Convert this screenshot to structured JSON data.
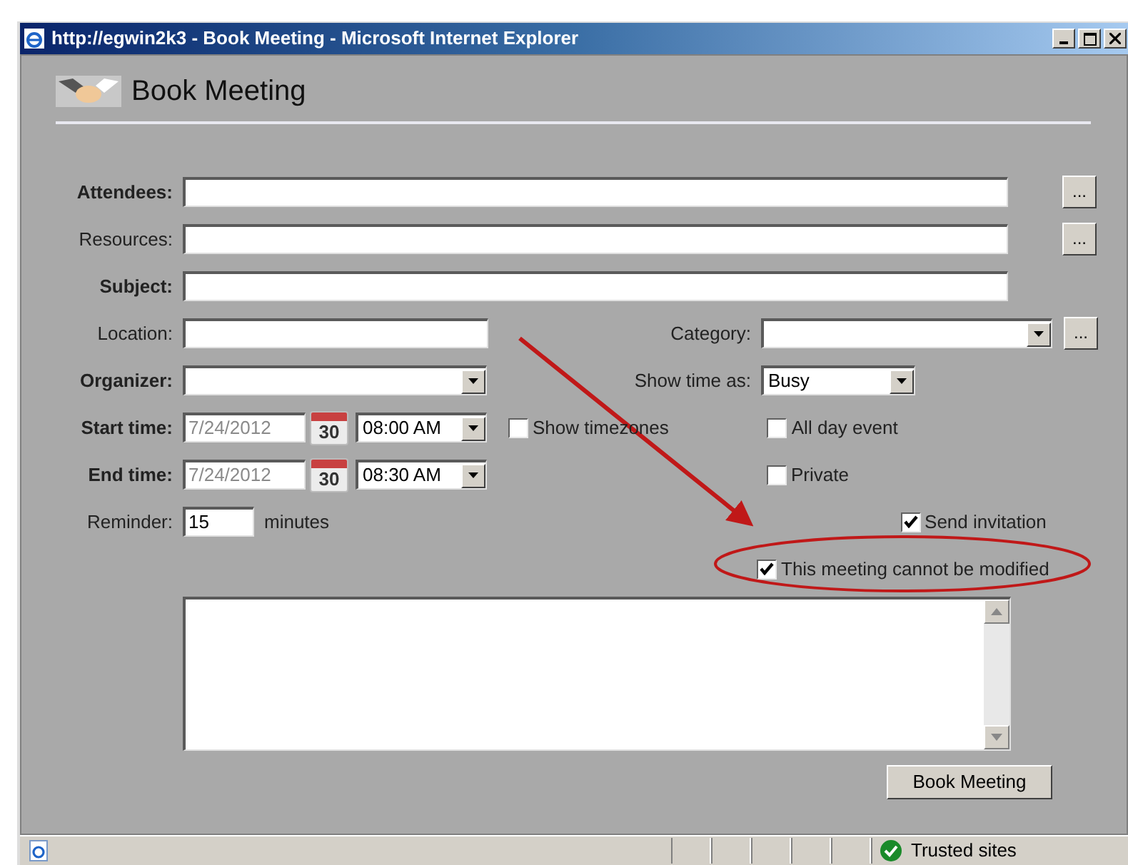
{
  "window": {
    "title": "http://egwin2k3 - Book Meeting - Microsoft Internet Explorer"
  },
  "heading": "Book Meeting",
  "attendees": {
    "label": "Attendees:",
    "button": "..."
  },
  "resources": {
    "label": "Resources:",
    "button": "..."
  },
  "subject": {
    "label": "Subject:"
  },
  "location": {
    "label": "Location:"
  },
  "category": {
    "label": "Category:",
    "button": "..."
  },
  "organizer": {
    "label": "Organizer:"
  },
  "show_time_as": {
    "label": "Show time as:",
    "value": "Busy"
  },
  "start_time": {
    "label": "Start time:",
    "date": "7/24/2012",
    "calendar_day": "30",
    "time": "08:00 AM"
  },
  "end_time": {
    "label": "End time:",
    "date": "7/24/2012",
    "calendar_day": "30",
    "time": "08:30 AM"
  },
  "reminder": {
    "label": "Reminder:",
    "value": "15",
    "unit": "minutes"
  },
  "checkboxes": [
    {
      "label": "Show timezones",
      "checked": false
    },
    {
      "label": "All day event",
      "checked": false
    },
    {
      "label": "Private",
      "checked": false
    },
    {
      "label": "Send invitation",
      "checked": true
    },
    {
      "label": "This meeting cannot be modified",
      "checked": true
    }
  ],
  "submit": "Book Meeting",
  "status_bar": {
    "zone": "Trusted sites"
  }
}
